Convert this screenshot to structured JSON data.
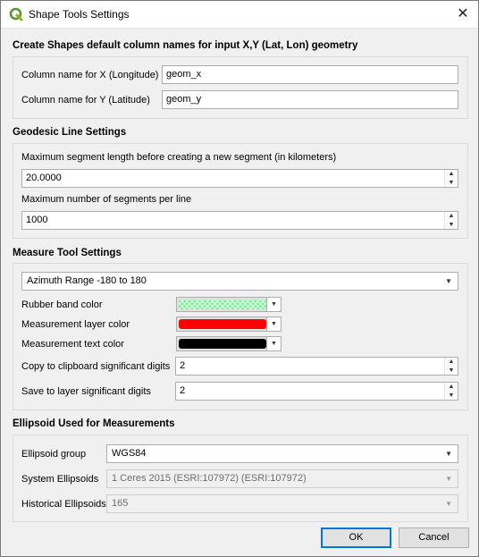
{
  "window": {
    "title": "Shape Tools Settings"
  },
  "sections": {
    "column_names": {
      "title": "Create Shapes default column names for input  X,Y (Lat, Lon) geometry",
      "x_label": "Column name for X (Longitude)",
      "x_value": "geom_x",
      "y_label": "Column name for Y (Latitude)",
      "y_value": "geom_y"
    },
    "geodesic": {
      "title": "Geodesic Line Settings",
      "max_segment_label": "Maximum segment length before creating a new segment (in kilometers)",
      "max_segment_value": "20.0000",
      "max_number_label": "Maximum number of segments per line",
      "max_number_value": "1000"
    },
    "measure": {
      "title": "Measure Tool Settings",
      "azimuth_range": "Azimuth Range -180 to 180",
      "rubber_band_label": "Rubber band color",
      "layer_color_label": "Measurement layer color",
      "text_color_label": "Measurement text color",
      "clipboard_digits_label": "Copy to clipboard significant digits",
      "clipboard_digits_value": "2",
      "save_digits_label": "Save to layer significant digits",
      "save_digits_value": "2"
    },
    "ellipsoid": {
      "title": "Ellipsoid Used for Measurements",
      "group_label": "Ellipsoid group",
      "group_value": "WGS84",
      "system_label": "System Ellipsoids",
      "system_value": "1 Ceres 2015 (ESRI:107972) (ESRI:107972)",
      "historical_label": "Historical Ellipsoids",
      "historical_value": "165"
    }
  },
  "buttons": {
    "ok": "OK",
    "cancel": "Cancel"
  },
  "colors": {
    "rubber_band": "#66ee88",
    "layer": "#ff0000",
    "text": "#000000",
    "accent": "#0078d7"
  },
  "icons": {
    "app": "qgis-logo-icon",
    "close": "close-icon"
  }
}
